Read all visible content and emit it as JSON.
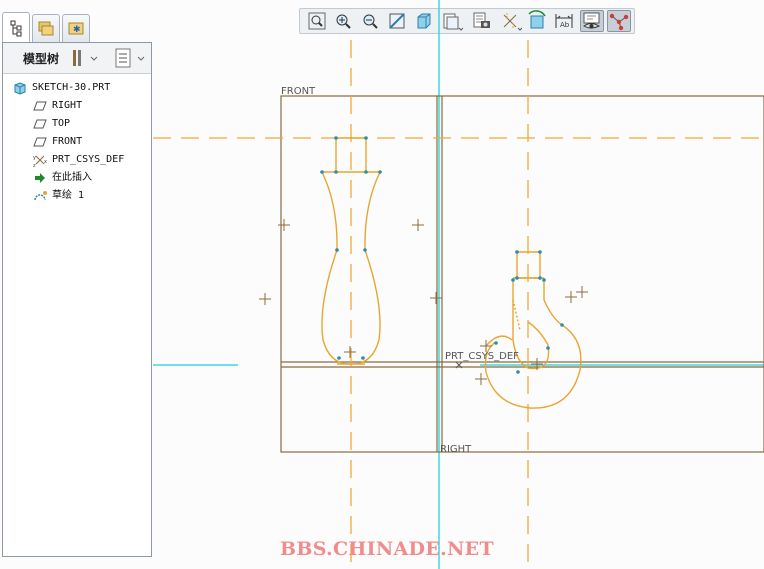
{
  "left_tabs": [
    {
      "name": "model-tree-tab",
      "icon": "tree-icon"
    },
    {
      "name": "folder-browser-tab",
      "icon": "folders-icon"
    },
    {
      "name": "favorites-tab",
      "icon": "star-folder-icon"
    }
  ],
  "panel": {
    "title": "模型树",
    "tree": [
      {
        "label": "SKETCH-30.PRT",
        "icon": "part-icon"
      },
      {
        "label": "RIGHT",
        "icon": "datum-plane-icon"
      },
      {
        "label": "TOP",
        "icon": "datum-plane-icon"
      },
      {
        "label": "FRONT",
        "icon": "datum-plane-icon"
      },
      {
        "label": "PRT_CSYS_DEF",
        "icon": "csys-icon"
      },
      {
        "label": "在此插入",
        "icon": "insert-arrow-icon"
      },
      {
        "label": "草绘 1",
        "icon": "sketch-icon"
      }
    ]
  },
  "toolbar": [
    "zoom-fit-icon",
    "zoom-in-icon",
    "zoom-out-icon",
    "repaint-icon",
    "shading-icon",
    "saved-views-icon",
    "view-manager-icon",
    "datum-display-icon",
    "spin-center-icon",
    "annotation-display-icon",
    "sketch-view-icon",
    "sketch-constraints-icon"
  ],
  "graphics": {
    "plane_labels": {
      "front": "FRONT",
      "right": "RIGHT",
      "csys": "PRT_CSYS_DEF"
    },
    "colors": {
      "plane": "#8b6a3e",
      "sketch": "#e8a530",
      "centerline": "#f0a93a",
      "axis": "#3fd6e0",
      "vertex": "#2a8fa8"
    }
  },
  "watermark": "BBS.CHINADE.NET"
}
